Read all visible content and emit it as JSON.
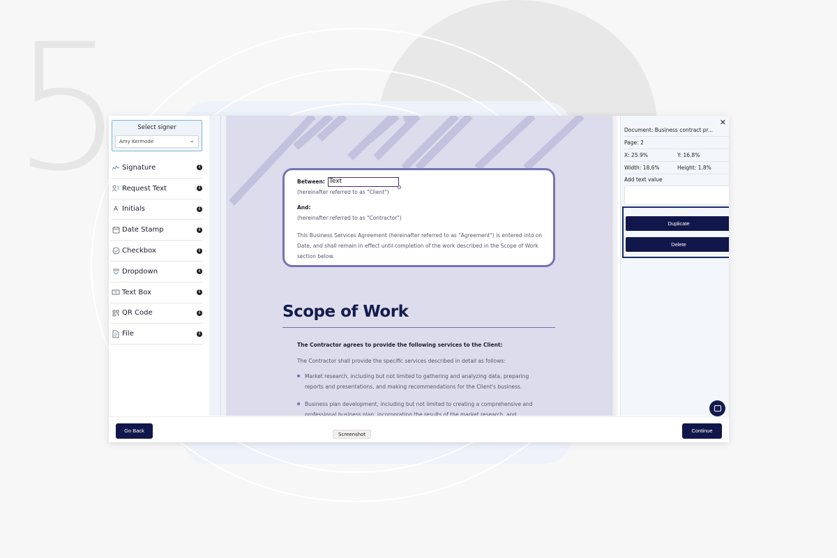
{
  "background": {
    "step_number": "5"
  },
  "sidebar": {
    "signer_title": "Select signer",
    "signer_value": "Amy Kermode",
    "tools": [
      {
        "label": "Signature",
        "icon": "signature-icon"
      },
      {
        "label": "Request Text",
        "icon": "request-text-icon"
      },
      {
        "label": "Initials",
        "icon": "initials-icon"
      },
      {
        "label": "Date Stamp",
        "icon": "calendar-icon"
      },
      {
        "label": "Checkbox",
        "icon": "checkbox-icon"
      },
      {
        "label": "Dropdown",
        "icon": "dropdown-icon"
      },
      {
        "label": "Text Box",
        "icon": "text-box-icon"
      },
      {
        "label": "QR Code",
        "icon": "qr-code-icon"
      },
      {
        "label": "File",
        "icon": "file-icon"
      }
    ],
    "info_glyph": "i"
  },
  "document": {
    "between_label": "Between:",
    "text_field_value": "Text",
    "client_note": "(hereinafter referred to as \"Client\")",
    "and_label": "And:",
    "contractor_note": "(hereinafter referred to as \"Contractor\")",
    "agreement_paragraph": "This Business Services Agreement (hereinafter referred to as \"Agreement\") is entered into on Date, and shall remain in effect until completion of the work described in the Scope of Work section below.",
    "scope_title": "Scope of Work",
    "scope_lead": "The Contractor agrees to provide the following services to the Client:",
    "scope_sub": "The Contractor shall provide the specific services described in detail as follows:",
    "bullets": [
      "Market research, including but not limited to gathering and analyzing data, preparing reports and presentations, and making recommendations for the Client's business.",
      "Business plan development, including but not limited to creating a comprehensive and professional business plan, incorporating the results of the market research, and"
    ]
  },
  "properties": {
    "close_glyph": "✕",
    "document": "Document: Business contract pr...",
    "page": "Page: 2",
    "x": "X: 25.9%",
    "y": "Y: 16.8%",
    "width": "Width: 18.6%",
    "height": "Height: 1.8%",
    "text_value_label": "Add text value",
    "text_value": "",
    "duplicate_label": "Duplicate",
    "delete_label": "Delete"
  },
  "footer": {
    "back_label": "Go Back",
    "continue_label": "Continue",
    "tooltip": "Screenshot"
  },
  "colors": {
    "primary": "#11174a",
    "accent_border": "#7673b4",
    "page_bg": "#dcdcec"
  }
}
